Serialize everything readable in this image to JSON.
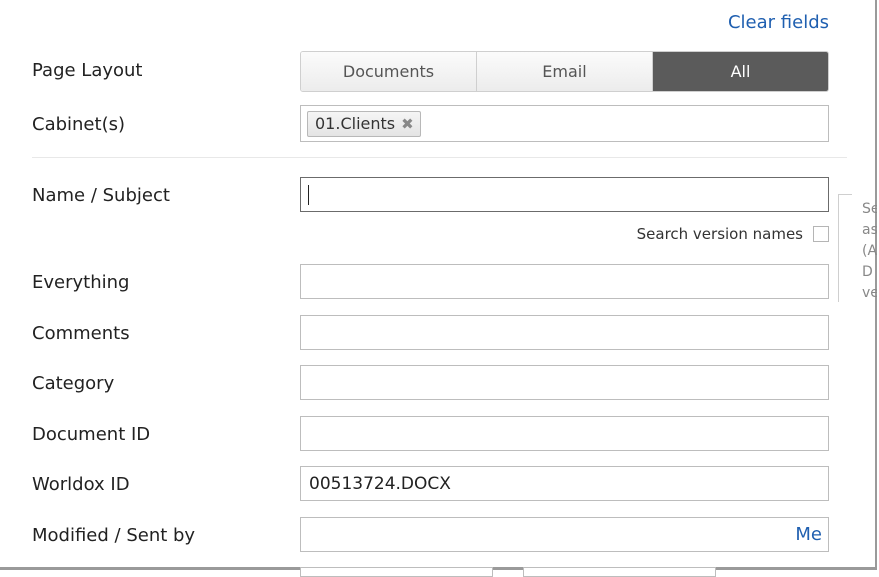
{
  "header": {
    "clear_fields": "Clear fields"
  },
  "labels": {
    "page_layout": "Page Layout",
    "cabinets": "Cabinet(s)",
    "name_subject": "Name / Subject",
    "everything": "Everything",
    "comments": "Comments",
    "category": "Category",
    "document_id": "Document ID",
    "worldox_id": "Worldox ID",
    "modified_sent_by": "Modified / Sent by"
  },
  "page_layout": {
    "options": [
      "Documents",
      "Email",
      "All"
    ],
    "selected": "All"
  },
  "cabinets": {
    "chips": [
      "01.Clients"
    ]
  },
  "fields": {
    "name_subject": "",
    "everything": "",
    "comments": "",
    "category": "",
    "document_id": "",
    "worldox_id": "00513724.DOCX",
    "modified_sent_by": ""
  },
  "search_version_names": {
    "label": "Search version names",
    "checked": false
  },
  "modified_sent_by_me": "Me",
  "tooltip": {
    "lines": [
      "Se",
      "as",
      "(A",
      "D",
      "ve"
    ]
  },
  "colors": {
    "link": "#1f5fb0",
    "segment_active": "#5b5b5b"
  }
}
